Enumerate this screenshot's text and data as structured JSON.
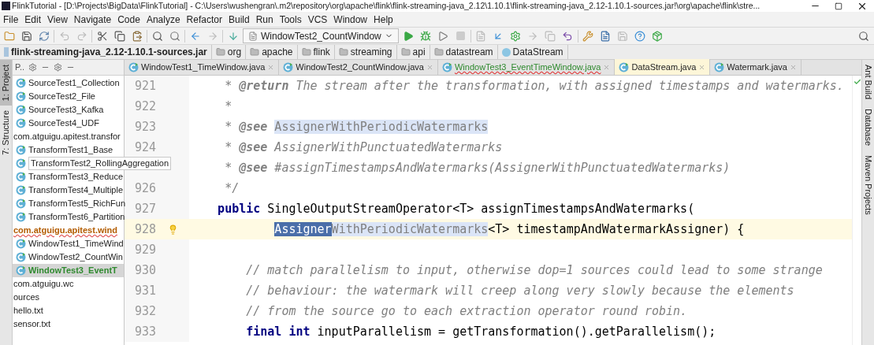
{
  "window": {
    "title": "FlinkTutorial - [D:\\Projects\\BigData\\FlinkTutorial] - C:\\Users\\wushengran\\.m2\\repository\\org\\apache\\flink\\flink-streaming-java_2.12\\1.10.1\\flink-streaming-java_2.12-1.10.1-sources.jar!\\org\\apache\\flink\\stre..."
  },
  "menu": [
    "File",
    "Edit",
    "View",
    "Navigate",
    "Code",
    "Analyze",
    "Refactor",
    "Build",
    "Run",
    "Tools",
    "VCS",
    "Window",
    "Help"
  ],
  "toolbar": {
    "run_config": "WindowTest2_CountWindow"
  },
  "breadcrumb": [
    {
      "label": "flink-streaming-java_2.12-1.10.1-sources.jar",
      "kind": "jar"
    },
    {
      "label": "org",
      "kind": "folder"
    },
    {
      "label": "apache",
      "kind": "folder"
    },
    {
      "label": "flink",
      "kind": "folder"
    },
    {
      "label": "streaming",
      "kind": "folder"
    },
    {
      "label": "api",
      "kind": "folder"
    },
    {
      "label": "datastream",
      "kind": "folder"
    },
    {
      "label": "DataStream",
      "kind": "class"
    }
  ],
  "left_strip": [
    {
      "label": "1: Project",
      "selected": true
    },
    {
      "label": "7: Structure",
      "selected": false
    }
  ],
  "project_panel": {
    "view": "P..",
    "items": [
      {
        "label": "SourceTest1_Collection",
        "kind": "class"
      },
      {
        "label": "SourceTest2_File",
        "kind": "class"
      },
      {
        "label": "SourceTest3_Kafka",
        "kind": "class"
      },
      {
        "label": "SourceTest4_UDF",
        "kind": "class"
      },
      {
        "label": "com.atguigu.apitest.transfor",
        "kind": "package",
        "error": false,
        "children": [
          {
            "label": "TransformTest1_Base",
            "kind": "class"
          },
          {
            "label": "TransformTest2_RollingAggregation",
            "kind": "class",
            "hovered": true
          },
          {
            "label": "TransformTest3_Reduce",
            "kind": "class"
          },
          {
            "label": "TransformTest4_Multiple",
            "kind": "class"
          },
          {
            "label": "TransformTest5_RichFun",
            "kind": "class"
          },
          {
            "label": "TransformTest6_Partition",
            "kind": "class"
          }
        ]
      },
      {
        "label": "com.atguigu.apitest.wind",
        "kind": "package",
        "error": true,
        "children": [
          {
            "label": "WindowTest1_TimeWind",
            "kind": "class"
          },
          {
            "label": "WindowTest2_CountWin",
            "kind": "class"
          },
          {
            "label": "WindowTest3_EventT",
            "kind": "class",
            "selected": true
          }
        ]
      },
      {
        "label": "com.atguigu.wc",
        "kind": "package",
        "error": false
      },
      {
        "label": "ources",
        "kind": "folder"
      },
      {
        "label": "hello.txt",
        "kind": "file"
      },
      {
        "label": "sensor.txt",
        "kind": "file"
      }
    ]
  },
  "tabs": [
    {
      "label": "WindowTest1_TimeWindow.java",
      "selected": false,
      "error": false
    },
    {
      "label": "WindowTest2_CountWindow.java",
      "selected": false,
      "error": false
    },
    {
      "label": "WindowTest3_EventTimeWindow.java",
      "selected": false,
      "error": true
    },
    {
      "label": "DataStream.java",
      "selected": true,
      "error": false
    },
    {
      "label": "Watermark.java",
      "selected": false,
      "error": false
    }
  ],
  "editor": {
    "lines": [
      {
        "number": "921",
        "current": false,
        "kind": "doc",
        "segments": [
          {
            "t": "*",
            "kind": "comment"
          },
          {
            "t": "@return",
            "kind": "tag"
          },
          {
            "t": "The stream after the transformation, with assigned timestamps and watermarks.",
            "kind": "comment"
          }
        ]
      },
      {
        "number": "922",
        "current": false,
        "kind": "doc",
        "segments": [
          {
            "t": "*",
            "kind": "comment"
          }
        ]
      },
      {
        "number": "923",
        "current": false,
        "kind": "doc",
        "segments": [
          {
            "t": "*",
            "kind": "comment"
          },
          {
            "t": "@see",
            "kind": "tag"
          },
          {
            "t": "AssignerWithPeriodicWatermarks",
            "kind": "usage"
          }
        ]
      },
      {
        "number": "924",
        "current": false,
        "kind": "doc",
        "segments": [
          {
            "t": "*",
            "kind": "comment"
          },
          {
            "t": "@see",
            "kind": "tag"
          },
          {
            "t": "AssignerWithPunctuatedWatermarks",
            "kind": "comment"
          }
        ]
      },
      {
        "current": false,
        "kind": "doc",
        "segments": [
          {
            "t": "*",
            "kind": "comment"
          },
          {
            "t": "@see",
            "kind": "tag"
          },
          {
            "t": "#assignTimestampsAndWatermarks(AssignerWithPunctuatedWatermarks)",
            "kind": "comment"
          }
        ]
      },
      {
        "number": "926",
        "current": false,
        "kind": "doc",
        "segments": [
          {
            "t": "*/",
            "kind": "comment"
          }
        ]
      },
      {
        "number": "927",
        "current": false,
        "kind": "member",
        "segments": [
          {
            "t": "public",
            "kind": "keyword"
          },
          {
            "t": "SingleOutputStreamOperator<T> assignTimestampsAndWatermarks(",
            "kind": "plain"
          }
        ]
      },
      {
        "number": "928",
        "current": true,
        "kind": "continuation",
        "segments": [
          {
            "t": "Assigner",
            "kind": "selection"
          },
          {
            "t": "WithPeriodicWatermarks",
            "kind": "usage"
          },
          {
            "t": "<T> timestampAndWatermarkAssigner) {",
            "kind": "plain"
          }
        ]
      },
      {
        "number": "929",
        "current": false
      },
      {
        "number": "930",
        "current": false,
        "kind": "body",
        "segments": [
          {
            "t": "// match parallelism to input, otherwise dop=1 sources could lead to some strange",
            "kind": "comment"
          }
        ]
      },
      {
        "number": "931",
        "current": false,
        "kind": "body",
        "segments": [
          {
            "t": "// behaviour: the watermark will creep along very slowly because the elements",
            "kind": "comment"
          }
        ]
      },
      {
        "number": "932",
        "current": false,
        "kind": "body",
        "segments": [
          {
            "t": "// from the source go to each extraction operator round robin.",
            "kind": "comment"
          }
        ]
      },
      {
        "number": "933",
        "current": false,
        "kind": "body",
        "segments": [
          {
            "t": "final int",
            "kind": "keyword"
          },
          {
            "t": "inputParallelism = getTransformation().getParallelism();",
            "kind": "plain"
          }
        ]
      }
    ]
  },
  "right_strip": [
    "Ant Build",
    "Database",
    "Maven Projects"
  ]
}
